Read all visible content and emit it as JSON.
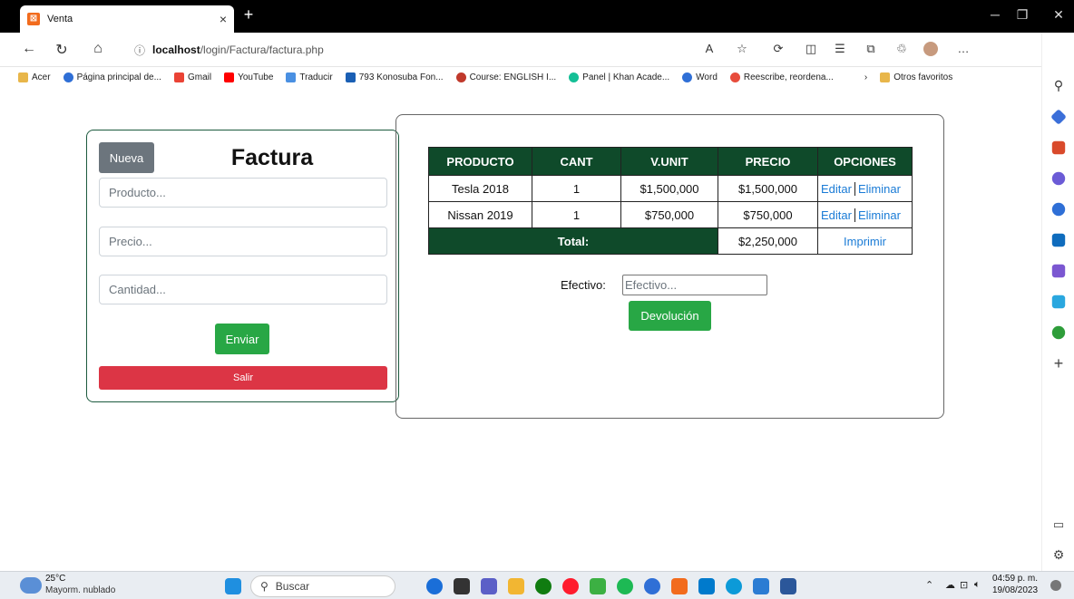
{
  "browser": {
    "tab_title": "Venta",
    "tab_close": "×",
    "new_tab": "+",
    "url_host": "localhost",
    "url_path": "/login/Factura/factura.php",
    "bookmarks": [
      "Acer",
      "Página principal de...",
      "Gmail",
      "YouTube",
      "Traducir",
      "793 Konosuba Fon...",
      "Course: ENGLISH I...",
      "Panel | Khan Acade...",
      "Word",
      "Reescribe, reordena..."
    ],
    "other_favorites": "Otros favoritos"
  },
  "form": {
    "nueva_label": "Nueva",
    "title": "Factura",
    "producto_placeholder": "Producto...",
    "precio_placeholder": "Precio...",
    "cantidad_placeholder": "Cantidad...",
    "enviar_label": "Enviar",
    "salir_label": "Salir"
  },
  "table": {
    "headers": [
      "PRODUCTO",
      "CANT",
      "V.UNIT",
      "PRECIO",
      "OPCIONES"
    ],
    "rows": [
      {
        "producto": "Tesla 2018",
        "cant": "1",
        "vunit": "$1,500,000",
        "precio": "$1,500,000",
        "edit": "Editar",
        "delete": "Eliminar"
      },
      {
        "producto": "Nissan 2019",
        "cant": "1",
        "vunit": "$750,000",
        "precio": "$750,000",
        "edit": "Editar",
        "delete": "Eliminar"
      }
    ],
    "total_label": "Total:",
    "total_value": "$2,250,000",
    "print_label": "Imprimir"
  },
  "payment": {
    "efectivo_label": "Efectivo:",
    "efectivo_placeholder": "Efectivo...",
    "devolucion_label": "Devolución"
  },
  "taskbar": {
    "temp": "25°C",
    "weather": "Mayorm. nublado",
    "search_placeholder": "Buscar",
    "time": "04:59 p. m.",
    "date": "19/08/2023"
  },
  "colors": {
    "table_header": "#0f4a2a",
    "success": "#28a745",
    "danger": "#dc3545",
    "secondary": "#6c757d",
    "link": "#1a7bd6"
  }
}
